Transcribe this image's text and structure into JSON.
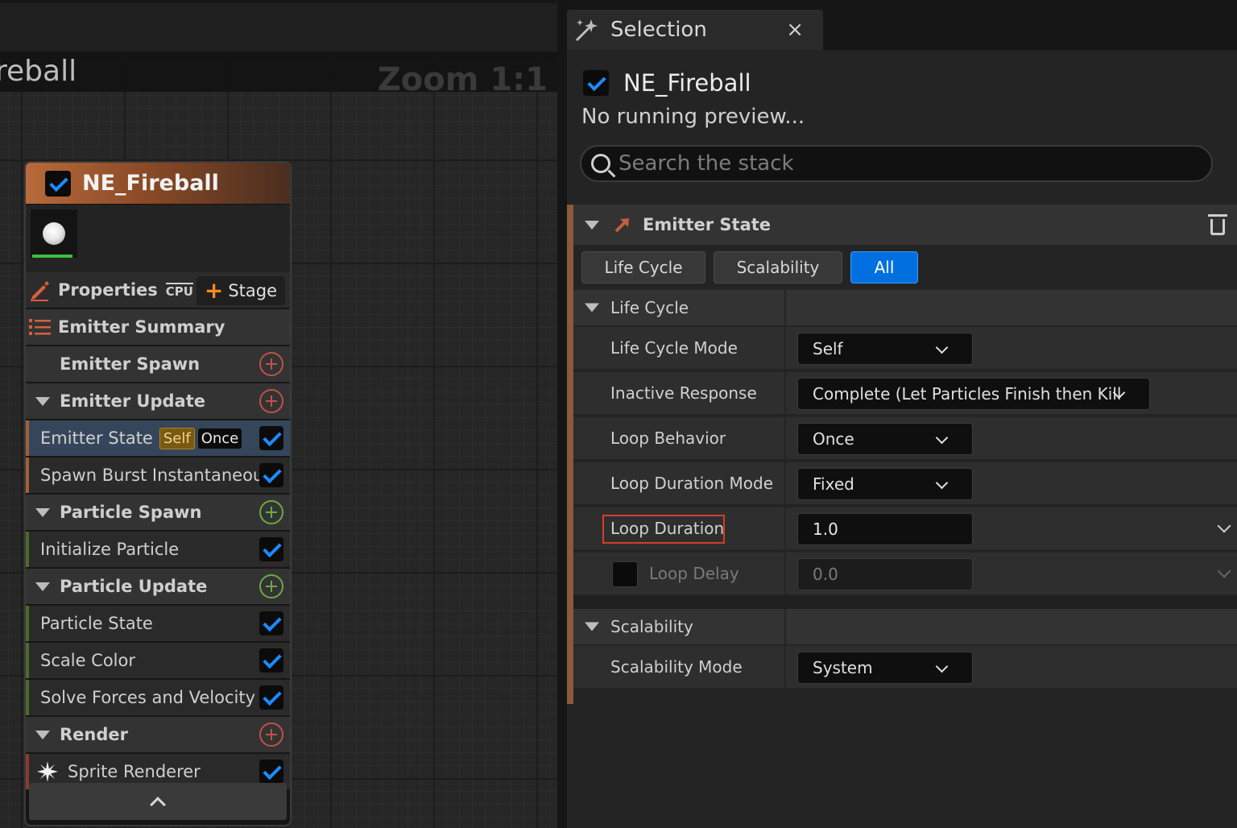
{
  "graph": {
    "title": "reball",
    "zoom_label": "Zoom 1:1"
  },
  "node": {
    "title": "NE_Fireball",
    "properties_label": "Properties",
    "cpu_label": "CPU",
    "stage_label": "Stage",
    "rows": [
      {
        "kind": "group",
        "label": "Emitter Summary"
      },
      {
        "kind": "group",
        "label": "Emitter Spawn"
      },
      {
        "kind": "group",
        "label": "Emitter Update"
      },
      {
        "kind": "item",
        "label": "Emitter State",
        "badges": [
          "Self",
          "Once"
        ],
        "selected": true
      },
      {
        "kind": "item",
        "label": "Spawn Burst Instantaneous"
      },
      {
        "kind": "group",
        "label": "Particle Spawn"
      },
      {
        "kind": "item",
        "label": "Initialize Particle"
      },
      {
        "kind": "group",
        "label": "Particle Update"
      },
      {
        "kind": "item",
        "label": "Particle State"
      },
      {
        "kind": "item",
        "label": "Scale Color"
      },
      {
        "kind": "item",
        "label": "Solve Forces and Velocity"
      },
      {
        "kind": "group",
        "label": "Render"
      },
      {
        "kind": "item",
        "label": "Sprite Renderer"
      }
    ]
  },
  "panel": {
    "tab_title": "Selection",
    "close_glyph": "×",
    "emitter_name": "NE_Fireball",
    "preview_text": "No running preview...",
    "search_placeholder": "Search the stack",
    "section_title": "Emitter State",
    "filters": [
      "Life Cycle",
      "Scalability",
      "All"
    ],
    "active_filter": "All",
    "life_cycle": {
      "category": "Life Cycle",
      "rows": [
        {
          "label": "Life Cycle Mode",
          "value": "Self"
        },
        {
          "label": "Inactive Response",
          "value": "Complete (Let Particles Finish then Kill"
        },
        {
          "label": "Loop Behavior",
          "value": "Once"
        },
        {
          "label": "Loop Duration Mode",
          "value": "Fixed"
        },
        {
          "label": "Loop Duration",
          "value": "1.0"
        },
        {
          "label": "Loop Delay",
          "value": "0.0"
        }
      ]
    },
    "scalability": {
      "category": "Scalability",
      "rows": [
        {
          "label": "Scalability Mode",
          "value": "System"
        }
      ]
    }
  }
}
